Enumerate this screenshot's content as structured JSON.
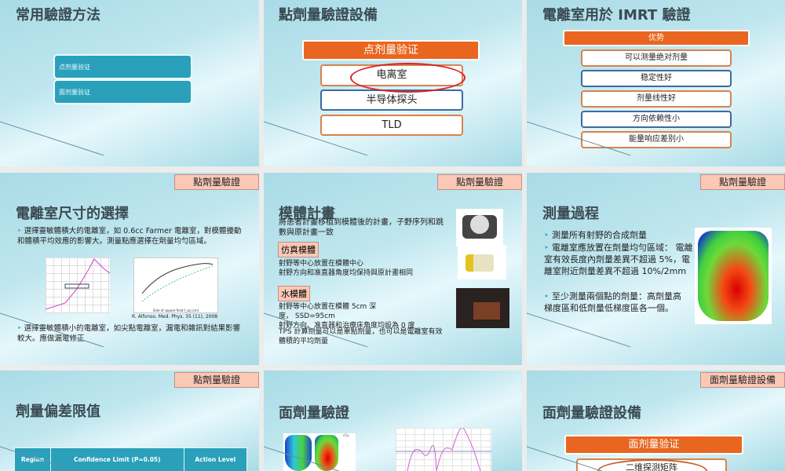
{
  "slides": [
    {
      "title": "常用驗證方法",
      "items": [
        "点剂量验证",
        "面剂量验证"
      ]
    },
    {
      "title": "點劑量驗證設備",
      "header": "点剂量验证",
      "items": [
        "电离室",
        "半导体探头",
        "TLD"
      ]
    },
    {
      "title": "電離室用於 IMRT 驗證",
      "header": "优势",
      "items": [
        "可以测量绝对剂量",
        "稳定性好",
        "剂量线性好",
        "方向依赖性小",
        "能量响应差别小"
      ]
    },
    {
      "tag": "點劑量驗證",
      "title": "電離室尺寸的選擇",
      "bullets": [
        "選擇靈敏體積大的電離室，如 0.6cc Farmer 電離室，對模體擾動和體積平均效應的影響大。測量點應選擇在劑量均勻區域。",
        "選擇靈敏體積小的電離室，如尖點電離室，漏電和雜訊對結果影響較大。應做漏電修正"
      ],
      "caption": "R. Alfonso, Med. Phys. 35 (11), 2008",
      "chart_xlabel": "Side of square field f_sq (cm)"
    },
    {
      "tag": "點劑量驗證",
      "title": "模體計畫",
      "intro": "將患者計畫移植到模體後的計畫，子野序列和跳數與原計畫一致",
      "sub1": "仿真模體",
      "sub1_lines": [
        "射野等中心放置在模體中心",
        "射野方向和准直器角度均保持與原計畫相同"
      ],
      "sub2": "水模體",
      "sub2_lines": [
        "射野等中心放置在模體 5cm 深度， SSD=95cm",
        "射野方向、准直器和治療床角度均設為 0 度",
        "TPS 計算劑量可以是單點劑量，也可以是電離室有效體積的平均劑量"
      ]
    },
    {
      "tag": "點劑量驗證",
      "title": "測量過程",
      "bullets": [
        "測量所有射野的合成劑量",
        "電離室應放置在劑量均勻區域： 電離室有效長度內劑量差異不超過 5%，電離室附近劑量差異不超過 10%/2mm",
        "至少測量兩個點的劑量：高劑量高梯度區和低劑量低梯度區各一個。"
      ]
    },
    {
      "tag": "點劑量驗證",
      "title": "劑量偏差限值",
      "table_headers": [
        "Region",
        "Confidence Limit (P=0.05)",
        "Action Level"
      ]
    },
    {
      "title": "面劑量驗證",
      "legend_unit": "cGy"
    },
    {
      "tag": "面劑量驗證設備",
      "title": "面劑量驗證設備",
      "header": "面剂量验证",
      "items": [
        "二维探测矩阵"
      ]
    }
  ],
  "colors": {
    "orange": "#e8661f",
    "blue": "#2aa0bb",
    "tag": "#fbc8b6"
  }
}
